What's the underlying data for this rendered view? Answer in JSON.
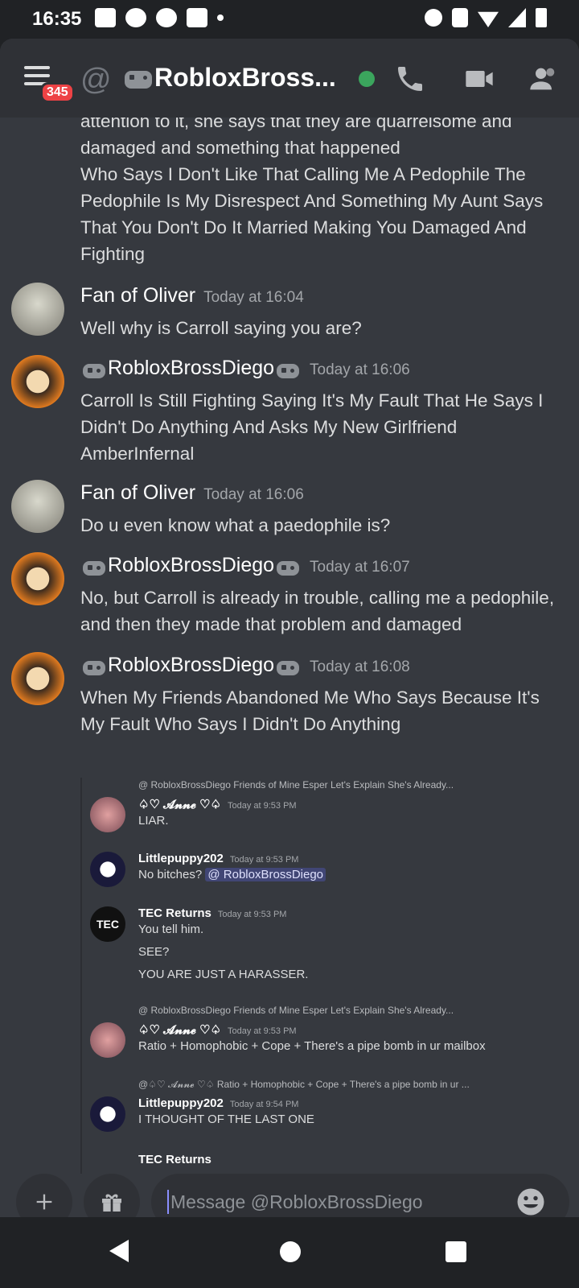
{
  "status_bar": {
    "time": "16:35"
  },
  "header": {
    "badge_count": "345",
    "title": "RobloxBross...",
    "online_color": "#3ba55d"
  },
  "messages": {
    "continuation_text": "attention to it, she says that they are quarrelsome and damaged and something that happened",
    "continuation_text2": "Who Says I Don't Like That Calling Me A Pedophile The Pedophile Is My Disrespect And Something My Aunt Says That You Don't Do It Married Making You Damaged And Fighting",
    "items": [
      {
        "author": "Fan of Oliver",
        "timestamp": "Today at 16:04",
        "text": "Well why is Carroll saying you are?"
      },
      {
        "author": "RobloxBrossDiego",
        "timestamp": "Today at 16:06",
        "text": "Carroll Is Still Fighting Saying It's My Fault That He Says I Didn't Do Anything And Asks My New Girlfriend AmberInfernal"
      },
      {
        "author": "Fan of Oliver",
        "timestamp": "Today at 16:06",
        "text": "Do u even know what a paedophile is?"
      },
      {
        "author": "RobloxBrossDiego",
        "timestamp": "Today at 16:07",
        "text": "No, but Carroll is already in trouble, calling me a pedophile, and then they made that problem and damaged"
      },
      {
        "author": "RobloxBrossDiego",
        "timestamp": "Today at 16:08",
        "text": "When My Friends Abandoned Me Who Says Because It's My Fault Who Says I Didn't Do Anything"
      }
    ]
  },
  "screenshot": {
    "reply1": "@ RobloxBrossDiego Friends of Mine Esper Let's Explain She's Already...",
    "m1_name": "♤♡ 𝓐𝓷𝓷𝓮 ♡♤",
    "m1_ts": "Today at 9:53 PM",
    "m1_text": "LIAR.",
    "m2_name": "Littlepuppy202",
    "m2_ts": "Today at 9:53 PM",
    "m2_text": "No bitches?",
    "m2_mention": "@ RobloxBrossDiego",
    "m3_avatar_text": "TEC",
    "m3_name": "TEC Returns",
    "m3_ts": "Today at 9:53 PM",
    "m3_line1": "You tell him.",
    "m3_line2": "SEE?",
    "m3_line3": "YOU ARE JUST A HARASSER.",
    "reply2": "@ RobloxBrossDiego Friends of Mine Esper Let's Explain She's Already...",
    "m4_name": "♤♡ 𝓐𝓷𝓷𝓮 ♡♤",
    "m4_ts": "Today at 9:53 PM",
    "m4_text": "Ratio + Homophobic + Cope + There's a pipe bomb in ur mailbox",
    "reply3": "@♤♡ 𝓐𝓷𝓷𝓮 ♡♤ Ratio + Homophobic + Cope + There's a pipe bomb in ur ...",
    "m5_name": "Littlepuppy202",
    "m5_ts": "Today at 9:54 PM",
    "m5_text": "I THOUGHT OF THE LAST ONE",
    "m6_name": "TEC Returns"
  },
  "composer": {
    "placeholder": "Message @RobloxBrossDiego"
  }
}
